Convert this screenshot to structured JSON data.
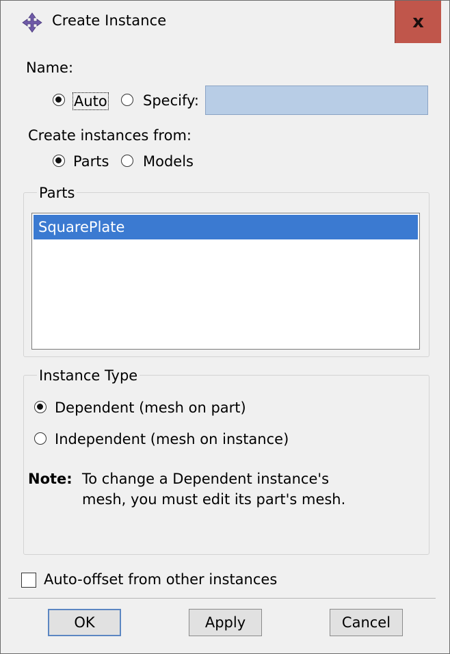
{
  "window": {
    "title": "Create Instance",
    "close_label": "x",
    "app_icon": "abaqus-dialog-icon"
  },
  "name_section": {
    "label": "Name:",
    "options": [
      {
        "label": "Auto",
        "selected": true
      },
      {
        "label": "Specify:",
        "selected": false
      }
    ],
    "specify_value": ""
  },
  "create_from": {
    "label": "Create instances from:",
    "options": [
      {
        "label": "Parts",
        "selected": true
      },
      {
        "label": "Models",
        "selected": false
      }
    ]
  },
  "parts_group": {
    "title": "Parts",
    "items": [
      {
        "label": "SquarePlate",
        "selected": true
      }
    ]
  },
  "instance_type": {
    "title": "Instance Type",
    "options": [
      {
        "label": "Dependent (mesh on part)",
        "selected": true
      },
      {
        "label": "Independent (mesh on instance)",
        "selected": false
      }
    ],
    "note_label": "Note:",
    "note_line1": "To change a Dependent instance's",
    "note_line2": "mesh, you must edit its part's mesh."
  },
  "auto_offset": {
    "label": "Auto-offset from other instances",
    "checked": false
  },
  "buttons": {
    "ok": "OK",
    "apply": "Apply",
    "cancel": "Cancel"
  },
  "colors": {
    "close_button": "#c0564b",
    "selection": "#3b7ad1",
    "specify_field": "#b8cde6"
  }
}
